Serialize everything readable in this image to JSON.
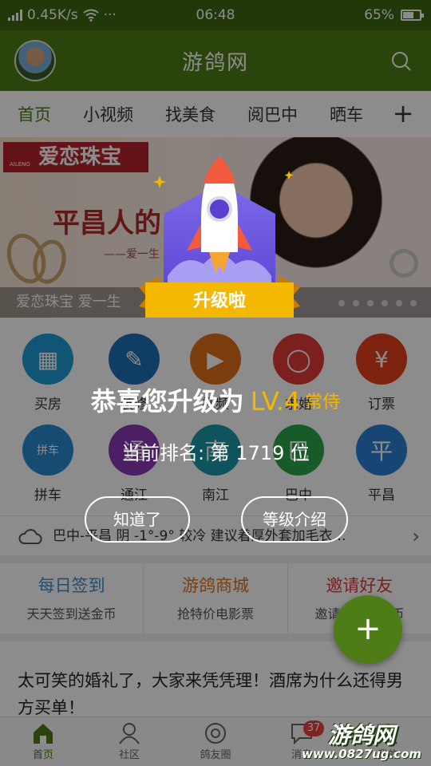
{
  "status_bar": {
    "network_speed": "0.45K/s",
    "more": "···",
    "time": "06:48",
    "battery": "65%",
    "battery_level": 0.65
  },
  "header": {
    "title": "游鸽网"
  },
  "tabs": [
    {
      "label": "首页",
      "active": true
    },
    {
      "label": "小视频"
    },
    {
      "label": "找美食"
    },
    {
      "label": "阅巴中"
    },
    {
      "label": "晒车"
    }
  ],
  "tab_more": "+",
  "banner": {
    "brand": "爱恋珠宝",
    "brand_sub": "AILENO",
    "slogan": "平昌人的",
    "slogan_sub": "——爱一生",
    "caption": "爱恋珠宝 爱一生"
  },
  "grid": [
    {
      "label": "买房",
      "icon": "building-icon",
      "color": "#1e9bd7",
      "glyph": "▦"
    },
    {
      "label": "装修",
      "icon": "paint-roller-icon",
      "color": "#1e6fb5",
      "glyph": "✎"
    },
    {
      "label": "视频",
      "icon": "play-icon",
      "color": "#e0701a",
      "glyph": "▶"
    },
    {
      "label": "求婚",
      "icon": "ring-icon",
      "color": "#e23a3a",
      "glyph": "◯"
    },
    {
      "label": "订票",
      "icon": "ticket-icon",
      "color": "#e6401d",
      "glyph": "¥"
    },
    {
      "label": "拼车",
      "icon": "taxi-icon",
      "color": "#2a8bd0",
      "glyph": "拼车"
    },
    {
      "label": "通江",
      "icon": "tongjiang-icon",
      "color": "#8b3ab8",
      "glyph": "通"
    },
    {
      "label": "南江",
      "icon": "nanjiang-icon",
      "color": "#1d9aa8",
      "glyph": "南"
    },
    {
      "label": "巴中",
      "icon": "bazhong-icon",
      "color": "#2aa84a",
      "glyph": "巴"
    },
    {
      "label": "平昌",
      "icon": "pingchang-icon",
      "color": "#2a7fd4",
      "glyph": "平"
    }
  ],
  "weather": {
    "text": "巴中-平昌 阴 -1°-9° 较冷 建议着厚外套加毛衣…",
    "chevron": "›"
  },
  "quick_actions": [
    {
      "title": "每日签到",
      "subtitle": "天天签到送金币",
      "color": "#3a8fd0"
    },
    {
      "title": "游鸽商城",
      "subtitle": "抢特价电影票",
      "color": "#e0701a"
    },
    {
      "title": "邀请好友",
      "subtitle": "邀请好友赚金币",
      "color": "#e23a3a"
    }
  ],
  "article": {
    "title": "太可笑的婚礼了，大家来凭凭理！酒席为什么还得男方买单！"
  },
  "fab": "+",
  "bottom_nav": [
    {
      "label": "首页",
      "icon": "home-icon",
      "active": true
    },
    {
      "label": "社区",
      "icon": "community-icon"
    },
    {
      "label": "鸽友圈",
      "icon": "circle-icon"
    },
    {
      "label": "消息",
      "icon": "message-icon",
      "badge": "37"
    },
    {
      "label": "我的",
      "icon": "profile-icon"
    }
  ],
  "dialog": {
    "badge_text": "升级啦",
    "congrats_prefix": "恭喜您升级为",
    "level": "LV.4",
    "level_title": "常侍",
    "rank_text": "当前排名: 第 1719 位",
    "ok_button": "知道了",
    "info_button": "等级介绍"
  },
  "watermark": {
    "line1": "游鸽网",
    "line2": "www.0827ug.com"
  }
}
